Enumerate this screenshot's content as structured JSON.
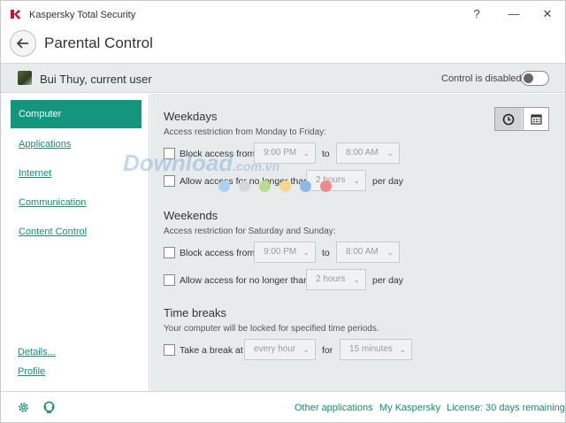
{
  "app": {
    "title": "Kaspersky Total Security",
    "help_glyph": "?",
    "minimize_glyph": "—",
    "close_glyph": "✕"
  },
  "header": {
    "title": "Parental Control"
  },
  "userbar": {
    "user": "Bui Thuy, current user",
    "control_status": "Control is disabled",
    "control_enabled": false
  },
  "sidebar": {
    "items": [
      {
        "label": "Computer",
        "active": true
      },
      {
        "label": "Applications",
        "active": false
      },
      {
        "label": "Internet",
        "active": false
      },
      {
        "label": "Communication",
        "active": false
      },
      {
        "label": "Content Control",
        "active": false
      }
    ],
    "details_link": "Details...",
    "profile_link": "Profile"
  },
  "weekdays": {
    "title": "Weekdays",
    "subtitle": "Access restriction from Monday to Friday:",
    "block_label": "Block access from",
    "block_from": "9:00 PM",
    "to_word": "to",
    "block_to": "8:00 AM",
    "allow_label": "Allow access for no longer than",
    "allow_hours": "2 hours",
    "per_day": "per day"
  },
  "weekends": {
    "title": "Weekends",
    "subtitle": "Access restriction for Saturday and Sunday:",
    "block_label": "Block access from",
    "block_from": "9:00 PM",
    "to_word": "to",
    "block_to": "8:00 AM",
    "allow_label": "Allow access for no longer than",
    "allow_hours": "2 hours",
    "per_day": "per day"
  },
  "breaks": {
    "title": "Time breaks",
    "subtitle": "Your computer will be locked for specified time periods.",
    "label": "Take a break at",
    "interval": "every hour",
    "for_word": "for",
    "duration": "15 minutes"
  },
  "watermark": {
    "text": "Download",
    "domain": ".com.vn",
    "dot_colors": [
      "#a9d3f0",
      "#d7d7d7",
      "#b6dc8c",
      "#f6d68a",
      "#8fb6e6",
      "#f08a8a"
    ]
  },
  "footer": {
    "other_apps": "Other applications",
    "my_kaspersky": "My Kaspersky",
    "license": "License: 30 days remaining"
  },
  "colors": {
    "accent": "#14967e",
    "link": "#1b8c73",
    "panel": "#e8ebec"
  }
}
